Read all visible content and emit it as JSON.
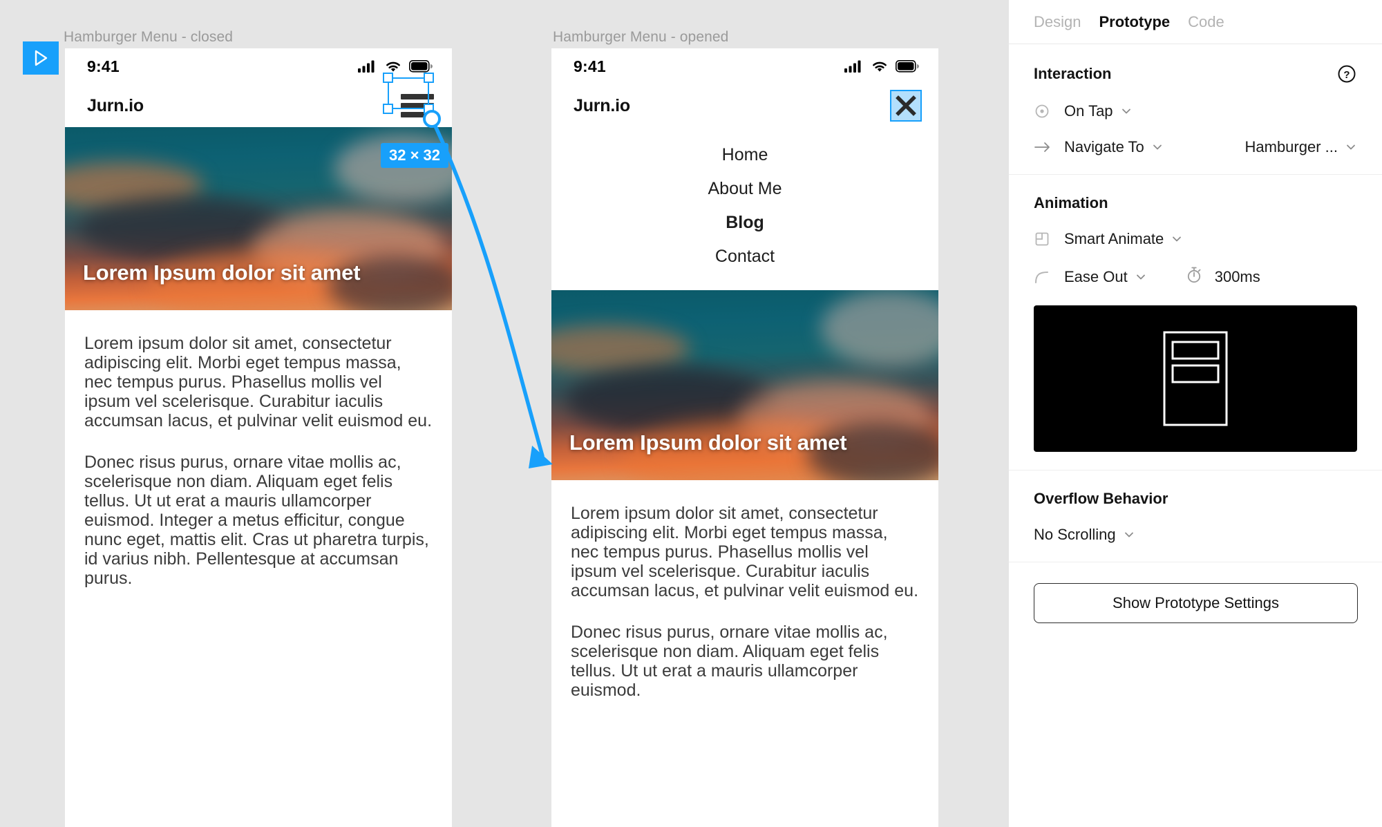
{
  "canvas": {
    "play_button": "play-icon",
    "frames": [
      {
        "label": "Hamburger Menu - closed",
        "status": {
          "time": "9:41",
          "cellular": "cellular-icon",
          "wifi": "wifi-icon",
          "battery": "battery-icon"
        },
        "brand": "Jurn.io",
        "menu_icon": "hamburger-icon",
        "hero_title": "Lorem Ipsum dolor sit amet",
        "paragraphs": [
          "Lorem ipsum dolor sit amet, consectetur adipiscing elit. Morbi eget tempus massa, nec tempus purus. Phasellus mollis vel ipsum vel scelerisque. Curabitur iaculis accumsan lacus, et pulvinar velit euismod eu.",
          "Donec risus purus, ornare vitae mollis ac, scelerisque non diam. Aliquam eget felis tellus. Ut ut erat a mauris ullamcorper euismod. Integer a metus efficitur, congue nunc eget, mattis elit. Cras ut pharetra turpis, id varius nibh. Pellentesque at accumsan purus."
        ]
      },
      {
        "label": "Hamburger Menu - opened",
        "status": {
          "time": "9:41",
          "cellular": "cellular-icon",
          "wifi": "wifi-icon",
          "battery": "battery-icon"
        },
        "brand": "Jurn.io",
        "menu_icon": "close-icon",
        "nav_items": [
          {
            "label": "Home",
            "active": false
          },
          {
            "label": "About Me",
            "active": false
          },
          {
            "label": "Blog",
            "active": true
          },
          {
            "label": "Contact",
            "active": false
          }
        ],
        "hero_title": "Lorem Ipsum dolor sit amet",
        "paragraphs": [
          "Lorem ipsum dolor sit amet, consectetur adipiscing elit. Morbi eget tempus massa, nec tempus purus. Phasellus mollis vel ipsum vel scelerisque. Curabitur iaculis accumsan lacus, et pulvinar velit euismod eu.",
          "Donec risus purus, ornare vitae mollis ac, scelerisque non diam. Aliquam eget felis tellus. Ut ut erat a mauris ullamcorper euismod."
        ]
      }
    ],
    "selection": {
      "size_badge": "32 × 32"
    },
    "accent_color": "#18a0fb"
  },
  "panel": {
    "tabs": [
      {
        "label": "Design",
        "active": false
      },
      {
        "label": "Prototype",
        "active": true
      },
      {
        "label": "Code",
        "active": false
      }
    ],
    "interaction": {
      "title": "Interaction",
      "help_icon": "help-circle-icon",
      "trigger": {
        "icon": "target-icon",
        "label": "On Tap",
        "chevron": "chevron-down-icon"
      },
      "action": {
        "icon": "arrow-right-icon",
        "label": "Navigate To",
        "chevron": "chevron-down-icon"
      },
      "destination": {
        "label": "Hamburger ...",
        "chevron": "chevron-down-icon"
      }
    },
    "animation": {
      "title": "Animation",
      "type": {
        "icon": "smart-animate-icon",
        "label": "Smart Animate",
        "chevron": "chevron-down-icon"
      },
      "easing": {
        "icon": "ease-curve-icon",
        "label": "Ease Out",
        "chevron": "chevron-down-icon"
      },
      "duration": {
        "icon": "stopwatch-icon",
        "value": "300ms"
      },
      "preview_icon": "hamburger-frame-preview"
    },
    "overflow": {
      "title": "Overflow Behavior",
      "value": {
        "label": "No Scrolling",
        "chevron": "chevron-down-icon"
      }
    },
    "show_settings_label": "Show Prototype Settings"
  }
}
